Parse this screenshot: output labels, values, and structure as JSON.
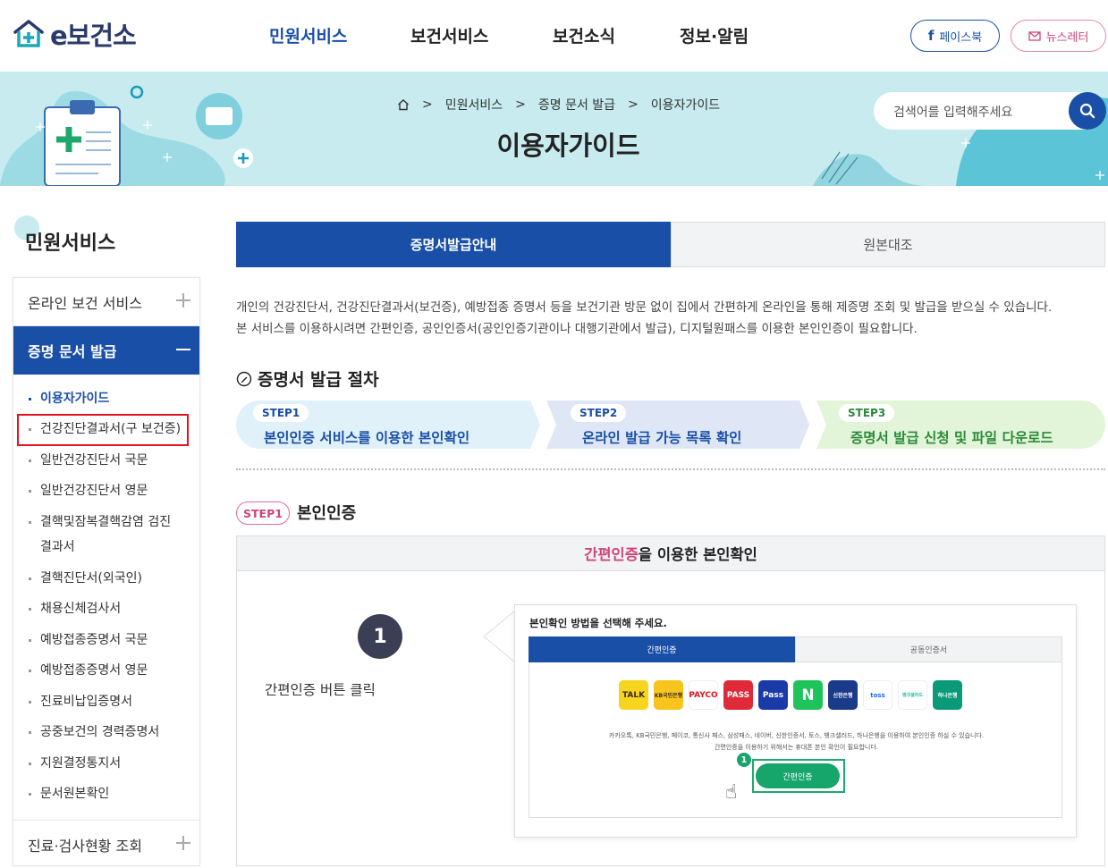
{
  "header": {
    "logo_text": "e보건소",
    "nav": [
      "민원서비스",
      "보건서비스",
      "보건소식",
      "정보·알림"
    ],
    "facebook": "페이스북",
    "newsletter": "뉴스레터"
  },
  "banner": {
    "breadcrumb": [
      "민원서비스",
      "증명 문서 발급",
      "이용자가이드"
    ],
    "title": "이용자가이드",
    "search_placeholder": "검색어를 입력해주세요"
  },
  "sidebar": {
    "title": "민원서비스",
    "menu": [
      {
        "label": "온라인 보건 서비스"
      },
      {
        "label": "증명 문서 발급"
      },
      {
        "label": "진료·검사현황 조회"
      }
    ],
    "sub": [
      "이용자가이드",
      "건강진단결과서(구 보건증)",
      "일반건강진단서 국문",
      "일반건강진단서 영문",
      "결핵및잠복결핵감염 검진결과서",
      "결핵진단서(외국인)",
      "채용신체검사서",
      "예방접종증명서 국문",
      "예방접종증명서 영문",
      "진료비납입증명서",
      "공중보건의 경력증명서",
      "지원결정통지서",
      "문서원본확인"
    ]
  },
  "tabs": [
    "증명서발급안내",
    "원본대조"
  ],
  "description": [
    "개인의 건강진단서, 건강진단결과서(보건증), 예방접종 증명서 등을 보건기관 방문 없이 집에서 간편하게 온라인을 통해 제증명 조회 및 발급을 받으실 수 있습니다.",
    "본 서비스를 이용하시려면 간편인증, 공인인증서(공인인증기관이나 대행기관에서 발급), 디지털원패스를 이용한 본인인증이 필요합니다."
  ],
  "procedure": {
    "title": "증명서 발급 절차",
    "steps": [
      {
        "label": "STEP1",
        "text": "본인인증 서비스를 이용한 본인확인"
      },
      {
        "label": "STEP2",
        "text": "온라인 발급 가능 목록 확인"
      },
      {
        "label": "STEP3",
        "text": "증명서 발급 신청 및 파일 다운로드"
      }
    ]
  },
  "step1": {
    "label": "STEP1",
    "title": "본인인증",
    "box_title_highlight": "간편인증",
    "box_title_rest": "을 이용한 본인확인",
    "number": "1",
    "instruction": "간편인증 버튼 클릭",
    "shot": {
      "question": "본인확인 방법을 선택해 주세요.",
      "tab_active": "간편인증",
      "tab_inactive": "공동인증서",
      "providers": [
        "TALK",
        "KB국민은행",
        "PAYCO",
        "PASS",
        "Pass",
        "N",
        "신한은행",
        "toss",
        "뱅크샐러드",
        "하나은행"
      ],
      "note1": "카카오톡, KB국민은행, 페이코, 통신사 패스, 삼성패스, 네이버, 신한인증서, 토스, 뱅크샐러드, 하나은행을 이용하여 본인인증 하실 수 있습니다.",
      "note2": "간편인증을 이용하기 위해서는 휴대폰 본인 확인이 필요합니다.",
      "button": "간편인증",
      "badge": "1"
    }
  },
  "colors": {
    "primary": "#1a4fa8",
    "pink": "#d0457a",
    "green": "#16a56a",
    "banner_bg": "#c7ebef"
  }
}
